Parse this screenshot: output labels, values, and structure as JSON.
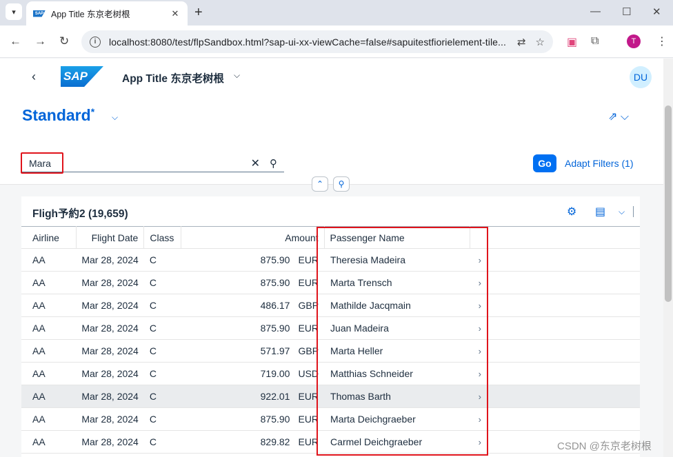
{
  "browser": {
    "tab_title": "App Title 东京老树根",
    "tab_menu_icon": "chevron-down-icon",
    "url": "localhost:8080/test/flpSandbox.html?sap-ui-xx-viewCache=false#sapuitestfiorielement-tile...",
    "profile_initial": "T"
  },
  "shell": {
    "logo_text": "SAP",
    "app_title": "App Title 东京老树根",
    "avatar_initials": "DU"
  },
  "header": {
    "variant_name": "Standard",
    "variant_modified": "*",
    "search_value": "Mara",
    "go_label": "Go",
    "adapt_filters_label": "Adapt Filters (1)"
  },
  "table": {
    "title": "Fligh予約2 (19,659)",
    "columns": [
      "Airline",
      "Flight Date",
      "Class",
      "Amount",
      "Passenger Name"
    ],
    "rows": [
      {
        "airline": "AA",
        "date": "Mar 28, 2024",
        "class": "C",
        "amount": "875.90",
        "currency": "EUR",
        "passenger": "Theresia Madeira"
      },
      {
        "airline": "AA",
        "date": "Mar 28, 2024",
        "class": "C",
        "amount": "875.90",
        "currency": "EUR",
        "passenger": "Marta Trensch"
      },
      {
        "airline": "AA",
        "date": "Mar 28, 2024",
        "class": "C",
        "amount": "486.17",
        "currency": "GBP",
        "passenger": "Mathilde Jacqmain"
      },
      {
        "airline": "AA",
        "date": "Mar 28, 2024",
        "class": "C",
        "amount": "875.90",
        "currency": "EUR",
        "passenger": "Juan Madeira"
      },
      {
        "airline": "AA",
        "date": "Mar 28, 2024",
        "class": "C",
        "amount": "571.97",
        "currency": "GBP",
        "passenger": "Marta Heller"
      },
      {
        "airline": "AA",
        "date": "Mar 28, 2024",
        "class": "C",
        "amount": "719.00",
        "currency": "USD",
        "passenger": "Matthias Schneider"
      },
      {
        "airline": "AA",
        "date": "Mar 28, 2024",
        "class": "C",
        "amount": "922.01",
        "currency": "EUR",
        "passenger": "Thomas Barth"
      },
      {
        "airline": "AA",
        "date": "Mar 28, 2024",
        "class": "C",
        "amount": "875.90",
        "currency": "EUR",
        "passenger": "Marta Deichgraeber"
      },
      {
        "airline": "AA",
        "date": "Mar 28, 2024",
        "class": "C",
        "amount": "829.82",
        "currency": "EUR",
        "passenger": "Carmel Deichgraeber"
      }
    ],
    "selected_row": 6
  },
  "watermark": "CSDN @东京老树根",
  "colors": {
    "brand_blue": "#0064d9",
    "go_button": "#0070f2",
    "highlight_red": "#e0131b"
  }
}
